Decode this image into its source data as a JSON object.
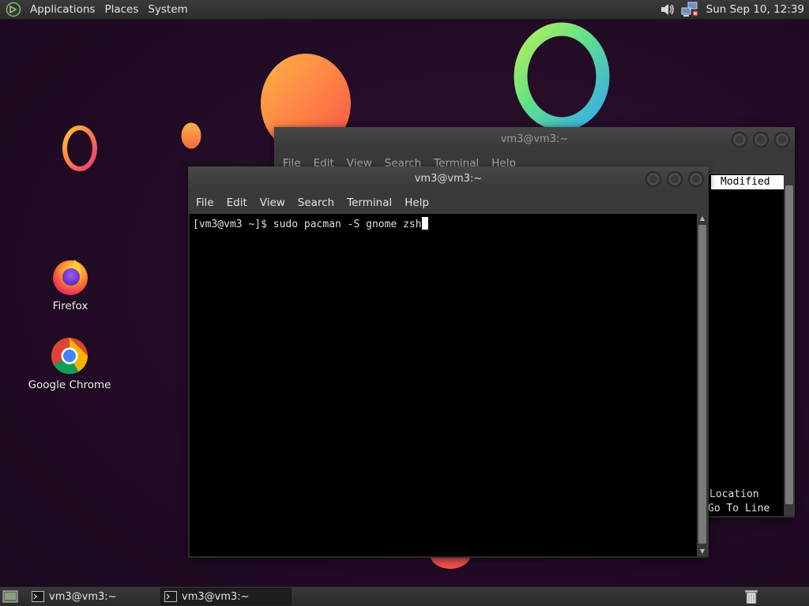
{
  "top_panel": {
    "menus": [
      "Applications",
      "Places",
      "System"
    ],
    "clock": "Sun Sep 10, 12:39",
    "icons": [
      "mate-logo-icon",
      "volume-icon",
      "network-icon"
    ]
  },
  "desktop_icons": [
    {
      "label": "Firefox",
      "icon": "firefox-icon"
    },
    {
      "label": "Google Chrome",
      "icon": "chrome-icon"
    }
  ],
  "back_window": {
    "title": "vm3@vm3:~",
    "menus": [
      "File",
      "Edit",
      "View",
      "Search",
      "Terminal",
      "Help"
    ],
    "header_cell": "Modified",
    "bottom_lines": [
      "Location",
      "Go To Line"
    ]
  },
  "front_window": {
    "title": "vm3@vm3:~",
    "menus": [
      "File",
      "Edit",
      "View",
      "Search",
      "Terminal",
      "Help"
    ],
    "prompt": "[vm3@vm3 ~]$ ",
    "command": "sudo pacman -S gnome zsh"
  },
  "taskbar": {
    "tasks": [
      {
        "label": "vm3@vm3:~",
        "active": false
      },
      {
        "label": "vm3@vm3:~",
        "active": true
      }
    ],
    "icons": [
      "show-desktop-icon",
      "trash-icon"
    ]
  },
  "colors": {
    "wallpaper": "#240d26",
    "panel": "#2c2c2c",
    "terminal_bg": "#000000"
  }
}
